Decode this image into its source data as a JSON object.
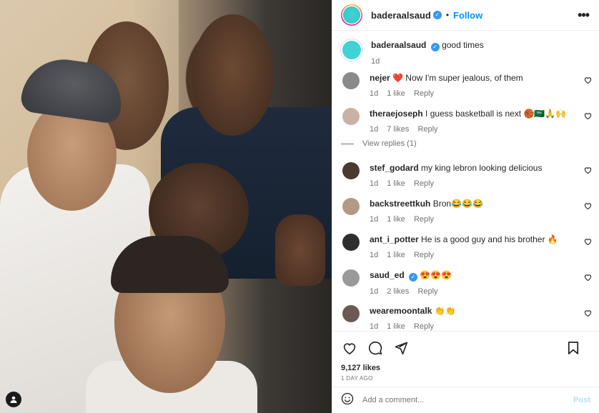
{
  "post_author": {
    "username": "baderaalsaud",
    "verified": true,
    "follow_label": "Follow",
    "more_label": "•••"
  },
  "caption": {
    "username": "baderaalsaud",
    "text": "good times",
    "time": "1d"
  },
  "comments": [
    {
      "username": "nejer",
      "text": "❤️ Now I'm super jealous, of them",
      "time": "1d",
      "likes": "1 like",
      "reply": "Reply",
      "avatar_color": "#8a8a8a"
    },
    {
      "username": "theraejoseph",
      "text": "I guess basketball is next 🏀🇸🇦🙏🙌",
      "time": "1d",
      "likes": "7 likes",
      "reply": "Reply",
      "avatar_color": "#c9b2a4",
      "view_replies": "View replies (1)"
    },
    {
      "username": "stef_godard",
      "text": "my king lebron looking delicious",
      "time": "1d",
      "likes": "1 like",
      "reply": "Reply",
      "avatar_color": "#4a3a30"
    },
    {
      "username": "backstreettkuh",
      "text": "Bron😂😂😂",
      "time": "1d",
      "likes": "1 like",
      "reply": "Reply",
      "avatar_color": "#b39a86"
    },
    {
      "username": "ant_i_potter",
      "text": "He is a good guy and his brother 🔥",
      "time": "1d",
      "likes": "1 like",
      "reply": "Reply",
      "avatar_color": "#2e2e2e"
    },
    {
      "username": "saud_ed",
      "text": "😍😍😍",
      "time": "1d",
      "likes": "2 likes",
      "reply": "Reply",
      "avatar_color": "#9a9a9a",
      "verified": true
    },
    {
      "username": "wearemoontalk",
      "text": "👏👏",
      "time": "1d",
      "likes": "1 like",
      "reply": "Reply",
      "avatar_color": "#6b5a54"
    }
  ],
  "likes": "9,127 likes",
  "posted": "1 DAY AGO",
  "add_comment": {
    "placeholder": "Add a comment...",
    "post_label": "Post"
  },
  "icons": [
    "heart-icon",
    "comment-icon",
    "share-icon",
    "save-icon",
    "emoji-icon",
    "user-tag-icon"
  ]
}
